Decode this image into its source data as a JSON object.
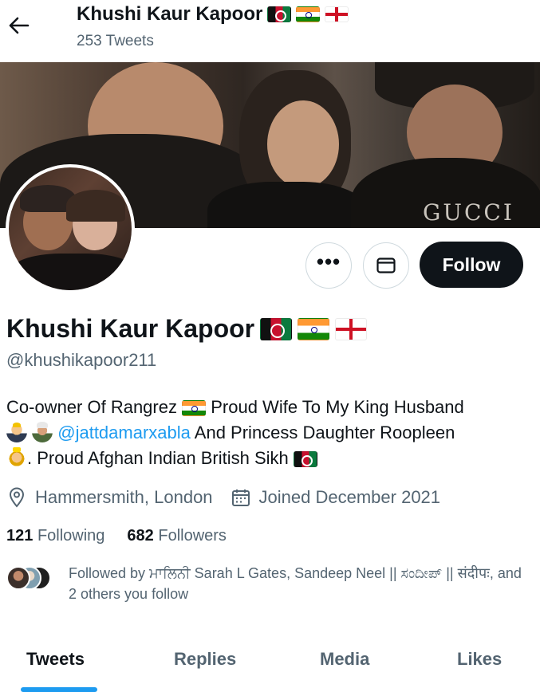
{
  "header": {
    "back_icon": "arrow-left-icon",
    "name": "Khushi Kaur Kapoor",
    "tweet_count": "253 Tweets"
  },
  "banner": {
    "shirt_text": "GUCCI"
  },
  "actions": {
    "more_label": "•••",
    "message_icon": "envelope-icon",
    "follow_label": "Follow"
  },
  "profile": {
    "display_name": "Khushi Kaur Kapoor",
    "flags": [
      "afghanistan-flag",
      "india-flag",
      "england-flag"
    ],
    "handle": "@khushikapoor211",
    "bio": {
      "part1": "Co-owner Of Rangrez",
      "part2": "Proud Wife To My King Husband",
      "mention": "@jattdamarxabla",
      "part3": "And Princess Daughter Roopleen",
      "part4": ". Proud Afghan Indian British Sikh"
    },
    "location": "Hammersmith, London",
    "joined": "Joined December 2021",
    "following_count": "121",
    "following_label": "Following",
    "followers_count": "682",
    "followers_label": "Followers",
    "followed_by": "Followed by ਮਾਲਿਨੀ Sarah L Gates, Sandeep Neel || ಸಂದೀಪ್ || संदीपः, and 2 others you follow"
  },
  "tabs": [
    "Tweets",
    "Replies",
    "Media",
    "Likes"
  ],
  "colors": {
    "accent": "#1d9bf0",
    "text": "#0f1419",
    "muted": "#536471",
    "follow_bg": "#0f1419"
  }
}
